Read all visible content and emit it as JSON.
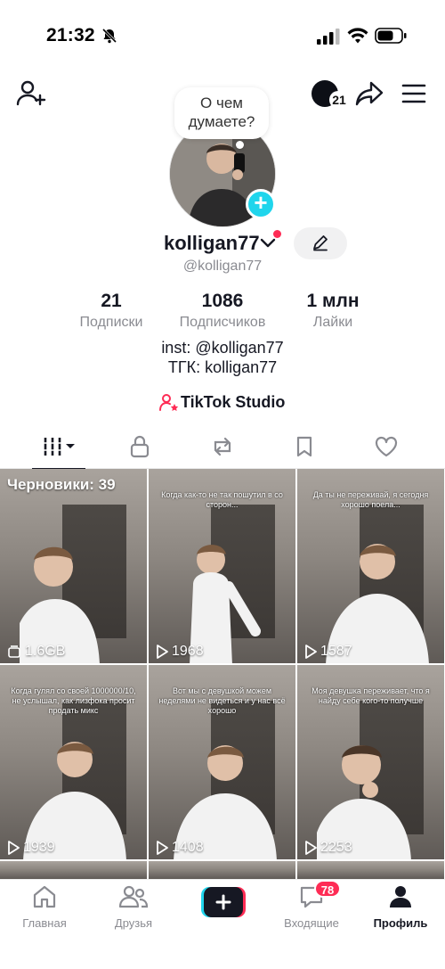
{
  "status_bar": {
    "time": "21:32"
  },
  "header": {
    "notification_count": "21"
  },
  "profile": {
    "bubble_text": "О чем думаете?",
    "username": "kolligan77",
    "handle": "@kolligan77",
    "stats": [
      {
        "value": "21",
        "label": "Подписки"
      },
      {
        "value": "1086",
        "label": "Подписчиков"
      },
      {
        "value": "1 млн",
        "label": "Лайки"
      }
    ],
    "bio_line_1": "inst: @kolligan77",
    "bio_line_2": "ТГК: kolligan77",
    "studio_label": "TikTok Studio"
  },
  "tabs": [
    "videos-tab",
    "private-tab",
    "reposts-tab",
    "favorites-tab",
    "liked-tab"
  ],
  "grid": {
    "drafts_label": "Черновики: 39",
    "items": [
      {
        "count": "1.6GB",
        "caption": ""
      },
      {
        "count": "1968",
        "caption": "Когда как-то не так пошутил в со сторон..."
      },
      {
        "count": "1587",
        "caption": "Да ты не переживай, я сегодня хорошо поела..."
      },
      {
        "count": "1939",
        "caption": "Когда гулял со своей 1000000/10, не услышал, как лизфока просит продать микс"
      },
      {
        "count": "1408",
        "caption": "Вот мы с девушкой можем неделями не видеться и у нас всё хорошо"
      },
      {
        "count": "2253",
        "caption": "Моя девушка переживает, что я найду себе кого-то получше"
      }
    ]
  },
  "bottom_nav": {
    "home": "Главная",
    "friends": "Друзья",
    "inbox": "Входящие",
    "inbox_badge": "78",
    "profile": "Профиль"
  },
  "colors": {
    "accent_red": "#fe2c55",
    "accent_cyan": "#20d5ec",
    "text_primary": "#161823",
    "text_secondary": "#8a8b91"
  }
}
